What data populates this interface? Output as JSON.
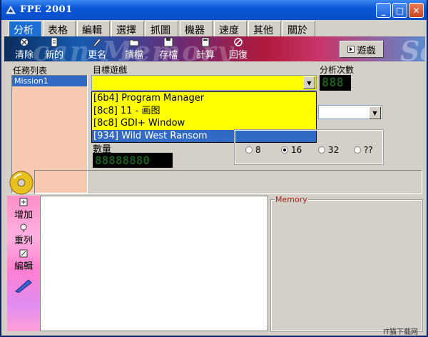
{
  "window": {
    "title": "FPE 2001"
  },
  "tabs": [
    "分析",
    "表格",
    "編輯",
    "選擇",
    "抓圖",
    "機器",
    "速度",
    "其他",
    "關於"
  ],
  "toolbar": {
    "items": [
      {
        "icon": "clear-icon",
        "label": "清除"
      },
      {
        "icon": "new-icon",
        "label": "新的"
      },
      {
        "icon": "rename-icon",
        "label": "更名"
      },
      {
        "icon": "open-file-icon",
        "label": "讀檔"
      },
      {
        "icon": "save-icon",
        "label": "存檔"
      },
      {
        "icon": "calc-icon",
        "label": "計算"
      },
      {
        "icon": "restore-icon",
        "label": "回復"
      }
    ],
    "banner": "can Memory",
    "banner2": "Sc",
    "game_button": "遊戲"
  },
  "task_list": {
    "label": "任務列表",
    "items": [
      "Mission1"
    ]
  },
  "target_game": {
    "label": "目標遊戲",
    "options": [
      "[6b4] Program Manager",
      "[8c8] 11 - 画图",
      "[8c8] GDI+ Window",
      "[934] Wild West Ransom"
    ]
  },
  "analysis_count": {
    "label": "分析次數",
    "value": "888"
  },
  "quantity": {
    "label": "數量",
    "value": "88888880"
  },
  "bits": {
    "options": [
      "8",
      "16",
      "32",
      "??"
    ],
    "selected": "16"
  },
  "side_buttons": [
    {
      "icon": "add-icon",
      "label": "增加"
    },
    {
      "icon": "relist-icon",
      "label": "重列"
    },
    {
      "icon": "edit-icon",
      "label": "編輯"
    }
  ],
  "memory": {
    "title": "Memory"
  },
  "watermark": "IT猫下载网",
  "colors": {
    "title_bar": "#0b56d8",
    "tab_active": "#1d6fd6",
    "highlight_yellow": "#ffff00",
    "selection": "#316ac5",
    "task_bg": "#f7c9b0"
  }
}
